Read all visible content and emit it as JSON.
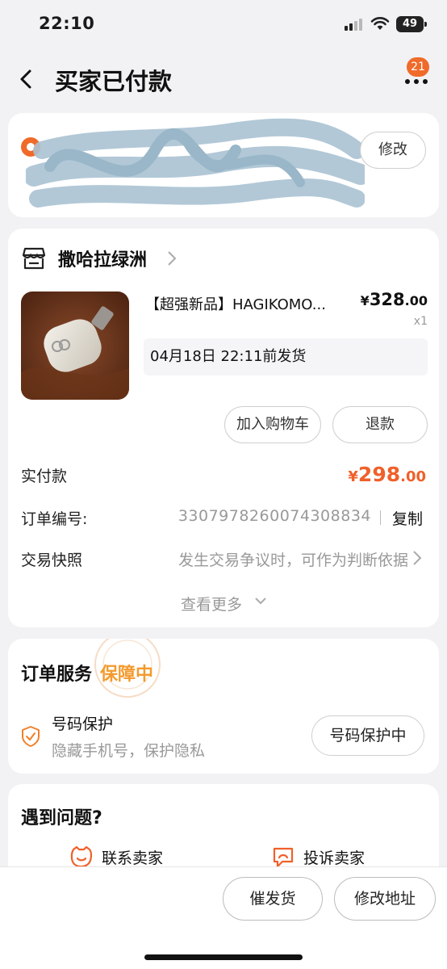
{
  "status_bar": {
    "time": "22:10",
    "battery": "49"
  },
  "header": {
    "title": "买家已付款",
    "notification_count": "21"
  },
  "address": {
    "edit_label": "修改"
  },
  "order": {
    "shop_name": "撒哈拉绿洲",
    "product": {
      "title": "【超强新品】HAGIKOMO...",
      "price_currency": "¥",
      "price_int": "328",
      "price_dec": ".00",
      "quantity": "x1",
      "ship_deadline": "04月18日 22:11前发货"
    },
    "add_cart_label": "加入购物车",
    "refund_label": "退款",
    "paid_label": "实付款",
    "paid_currency": "¥",
    "paid_int": "298",
    "paid_dec": ".00",
    "order_no_label": "订单编号:",
    "order_no": "3307978260074308834",
    "copy_label": "复制",
    "snapshot_label": "交易快照",
    "snapshot_desc": "发生交易争议时，可作为判断依据",
    "see_more_label": "查看更多"
  },
  "service": {
    "title": "订单服务",
    "status": "保障中",
    "item_name": "号码保护",
    "item_desc": "隐藏手机号，保护隐私",
    "item_button": "号码保护中"
  },
  "help": {
    "title": "遇到问题?",
    "contact_label": "联系卖家",
    "complain_label": "投诉卖家"
  },
  "bottom_bar": {
    "urge_label": "催发货",
    "change_address_label": "修改地址"
  },
  "colors": {
    "accent": "#f0602a",
    "guarantee": "#f39a2d",
    "page_bg": "#f2f2f4"
  },
  "icons": [
    "back-icon",
    "more-icon",
    "location-pin-icon",
    "shop-icon",
    "chevron-right-icon",
    "chevron-down-icon",
    "shield-icon",
    "chat-face-icon",
    "complaint-icon",
    "signal-icon",
    "wifi-icon",
    "battery-icon"
  ]
}
